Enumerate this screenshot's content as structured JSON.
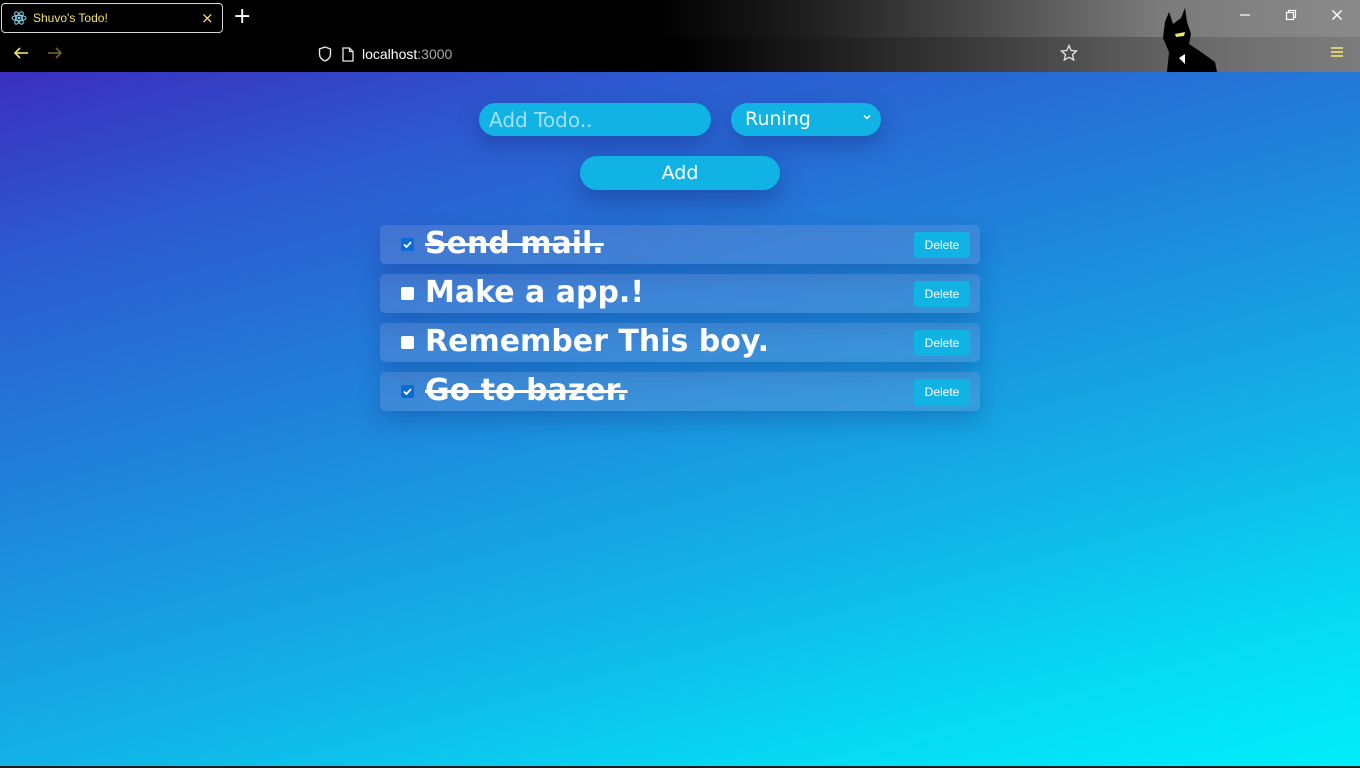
{
  "browser": {
    "tab_title": "Shuvo's Todo!",
    "tab_close": "×",
    "new_tab": "+",
    "url_host": "localhost",
    "url_port": ":3000",
    "window_controls": {
      "minimize": "—",
      "restore": "❐",
      "close": "✕"
    },
    "icons": [
      "react-icon",
      "back-icon",
      "forward-icon",
      "shield-icon",
      "page-icon",
      "star-icon",
      "menu-icon",
      "minimize-icon",
      "restore-icon",
      "close-icon"
    ]
  },
  "form": {
    "input_placeholder": "Add Todo..",
    "input_value": "",
    "status_selected": "Runing",
    "add_label": "Add"
  },
  "todos": [
    {
      "text": "Send mail.",
      "completed": true,
      "delete_label": "Delete"
    },
    {
      "text": "Make a app.!",
      "completed": false,
      "delete_label": "Delete"
    },
    {
      "text": "Remember This boy.",
      "completed": false,
      "delete_label": "Delete"
    },
    {
      "text": "Go to bazer.",
      "completed": true,
      "delete_label": "Delete"
    }
  ],
  "colors": {
    "accent": "#10b3e4",
    "tab_text": "#f3e36a",
    "gradient_top": "#3a2fbf",
    "gradient_bottom": "#00eefa"
  }
}
